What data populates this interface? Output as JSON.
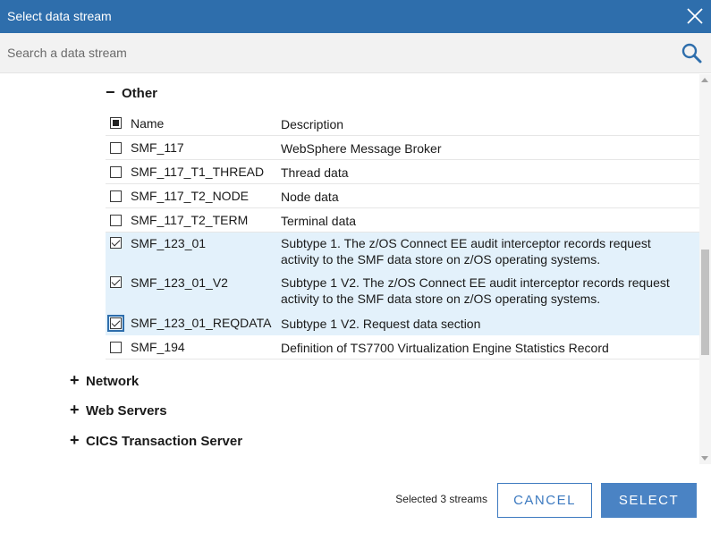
{
  "dialog": {
    "title": "Select data stream",
    "close_icon": "close-icon"
  },
  "search": {
    "placeholder": "Search a data stream",
    "value": "",
    "icon": "search-icon"
  },
  "groups": {
    "other": {
      "label": "Other",
      "sign": "−",
      "expanded": true
    },
    "network": {
      "label": "Network",
      "sign": "+",
      "expanded": false
    },
    "web_servers": {
      "label": "Web Servers",
      "sign": "+",
      "expanded": false
    },
    "cics": {
      "label": "CICS Transaction Server",
      "sign": "+",
      "expanded": false
    }
  },
  "table": {
    "header": {
      "name": "Name",
      "description": "Description",
      "select_all_state": "partial"
    },
    "rows": [
      {
        "name": "SMF_117",
        "description": "WebSphere Message Broker",
        "checked": false
      },
      {
        "name": "SMF_117_T1_THREAD",
        "description": "Thread data",
        "checked": false
      },
      {
        "name": "SMF_117_T2_NODE",
        "description": "Node data",
        "checked": false
      },
      {
        "name": "SMF_117_T2_TERM",
        "description": "Terminal data",
        "checked": false
      },
      {
        "name": "SMF_123_01",
        "description": "Subtype 1. The z/OS Connect EE audit interceptor records request activity to the SMF data store on z/OS operating systems.",
        "checked": true
      },
      {
        "name": "SMF_123_01_V2",
        "description": "Subtype 1 V2. The z/OS Connect EE audit interceptor records request activity to the SMF data store on z/OS operating systems.",
        "checked": true
      },
      {
        "name": "SMF_123_01_REQDATA",
        "description": "Subtype 1 V2. Request data section",
        "checked": true
      },
      {
        "name": "SMF_194",
        "description": "Definition of TS7700 Virtualization Engine Statistics Record",
        "checked": false
      }
    ]
  },
  "footer": {
    "status": "Selected 3 streams",
    "cancel_label": "CANCEL",
    "select_label": "SELECT"
  },
  "colors": {
    "titlebar": "#2e6eac",
    "selected_row": "#e3f1fb",
    "primary_button": "#4a83c4"
  }
}
